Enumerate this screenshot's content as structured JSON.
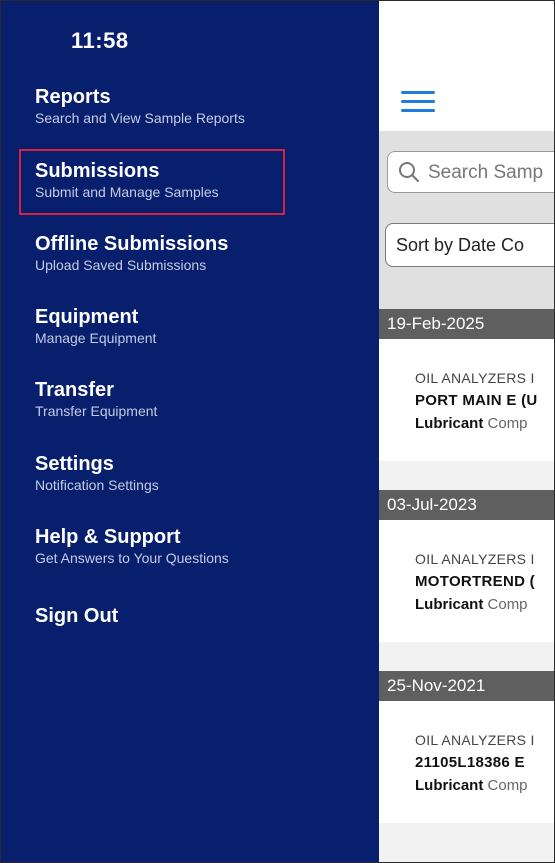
{
  "status_bar": {
    "time": "11:58"
  },
  "drawer": {
    "items": [
      {
        "title": "Reports",
        "subtitle": "Search and View Sample Reports"
      },
      {
        "title": "Submissions",
        "subtitle": "Submit and Manage Samples"
      },
      {
        "title": "Offline Submissions",
        "subtitle": "Upload Saved Submissions"
      },
      {
        "title": "Equipment",
        "subtitle": "Manage Equipment"
      },
      {
        "title": "Transfer",
        "subtitle": "Transfer Equipment"
      },
      {
        "title": "Settings",
        "subtitle": "Notification Settings"
      },
      {
        "title": "Help & Support",
        "subtitle": "Get Answers to Your Questions"
      },
      {
        "title": "Sign Out",
        "subtitle": ""
      }
    ],
    "highlighted_item": "Submissions",
    "highlight_color": "#d8203f",
    "background_color": "#081f6e"
  },
  "main": {
    "menu_icon": "hamburger-icon",
    "search": {
      "icon": "search-icon",
      "placeholder": "Search Samp"
    },
    "sort": {
      "label": "Sort by Date Co"
    },
    "groups": [
      {
        "date": "19-Feb-2025",
        "sample": {
          "lab": "OIL ANALYZERS I",
          "unit": "PORT MAIN E (U",
          "component_bold": "Lubricant",
          "component_label": "Comp"
        }
      },
      {
        "date": "03-Jul-2023",
        "sample": {
          "lab": "OIL ANALYZERS I",
          "unit": "MOTORTREND (",
          "component_bold": "Lubricant",
          "component_label": "Comp"
        }
      },
      {
        "date": "25-Nov-2021",
        "sample": {
          "lab": "OIL ANALYZERS I",
          "unit": "21105L18386 E",
          "component_bold": "Lubricant",
          "component_label": "Comp"
        }
      }
    ],
    "accent_color": "#1e7be0"
  }
}
